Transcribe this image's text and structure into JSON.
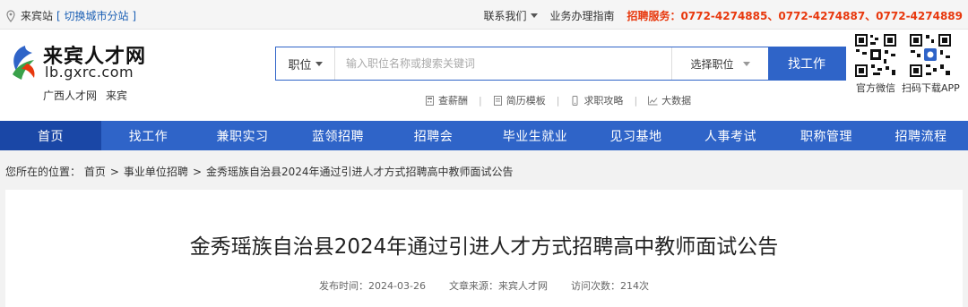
{
  "topbar": {
    "location_icon": "location-pin-icon",
    "site": "来宾站",
    "switch_label": "[ 切换城市分站 ]",
    "contact_label": "联系我们",
    "guide_label": "业务办理指南",
    "service_hotline": "招聘服务：0772-4274885、0772-4274887、0772-4274889"
  },
  "logo": {
    "name_cn": "来宾人才网",
    "domain": "lb.gxrc.com",
    "sub1": "广西人才网",
    "sub2": "来宾"
  },
  "search": {
    "category": "职位",
    "placeholder": "输入职位名称或搜索关键词",
    "position_select": "选择职位",
    "button": "找工作"
  },
  "quick_links": [
    {
      "icon": "calculator-icon",
      "label": "查薪酬"
    },
    {
      "icon": "document-icon",
      "label": "简历模板"
    },
    {
      "icon": "phone-icon",
      "label": "求职攻略"
    },
    {
      "icon": "trend-chart-icon",
      "label": "大数据"
    }
  ],
  "qr": {
    "wechat_label": "官方微信",
    "app_label": "扫码下载APP"
  },
  "nav": [
    "首页",
    "找工作",
    "兼职实习",
    "蓝领招聘",
    "招聘会",
    "毕业生就业",
    "见习基地",
    "人事考试",
    "职称管理",
    "招聘流程"
  ],
  "breadcrumb": {
    "prefix": "您所在的位置：",
    "items": [
      "首页",
      "事业单位招聘",
      "金秀瑶族自治县2024年通过引进人才方式招聘高中教师面试公告"
    ]
  },
  "article": {
    "title": "金秀瑶族自治县2024年通过引进人才方式招聘高中教师面试公告",
    "publish_time": "发布时间：2024-03-26",
    "source": "文章来源：来宾人才网",
    "visits": "访问次数：214次"
  },
  "colors": {
    "primary": "#2f64c8",
    "nav_active": "#1a47a6",
    "hotline": "#e8380d"
  }
}
